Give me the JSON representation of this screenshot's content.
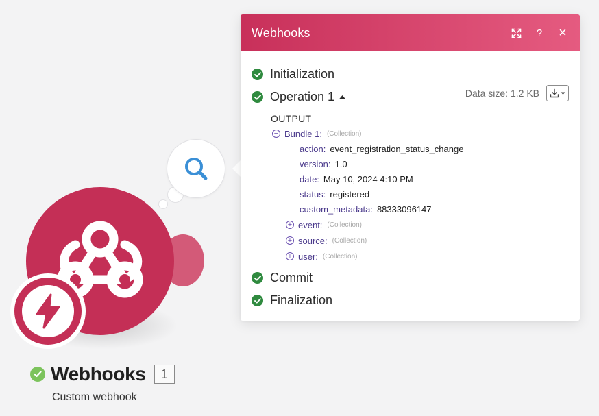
{
  "panel": {
    "title": "Webhooks",
    "actions": {
      "expand_icon": "expand-icon",
      "help_label": "?",
      "close_label": "×"
    },
    "phases": {
      "initialization": "Initialization",
      "operation": "Operation 1",
      "commit": "Commit",
      "finalization": "Finalization"
    },
    "data_size": "Data size: 1.2 KB",
    "output_label": "OUTPUT",
    "bundle": {
      "key": "Bundle 1:",
      "type": "(Collection)",
      "fields": [
        {
          "key": "action:",
          "value": "event_registration_status_change"
        },
        {
          "key": "version:",
          "value": "1.0"
        },
        {
          "key": "date:",
          "value": "May 10, 2024 4:10 PM"
        },
        {
          "key": "status:",
          "value": "registered"
        },
        {
          "key": "custom_metadata:",
          "value": "88333096147"
        }
      ],
      "collections": [
        {
          "key": "event:",
          "type": "(Collection)"
        },
        {
          "key": "source:",
          "type": "(Collection)"
        },
        {
          "key": "user:",
          "type": "(Collection)"
        }
      ]
    }
  },
  "module": {
    "title": "Webhooks",
    "count": "1",
    "subtitle": "Custom webhook"
  },
  "colors": {
    "brand": "#c42f56",
    "header_gradient_end": "#e55b80",
    "success": "#2f8a3f",
    "tree_key": "#4b3a8c"
  }
}
